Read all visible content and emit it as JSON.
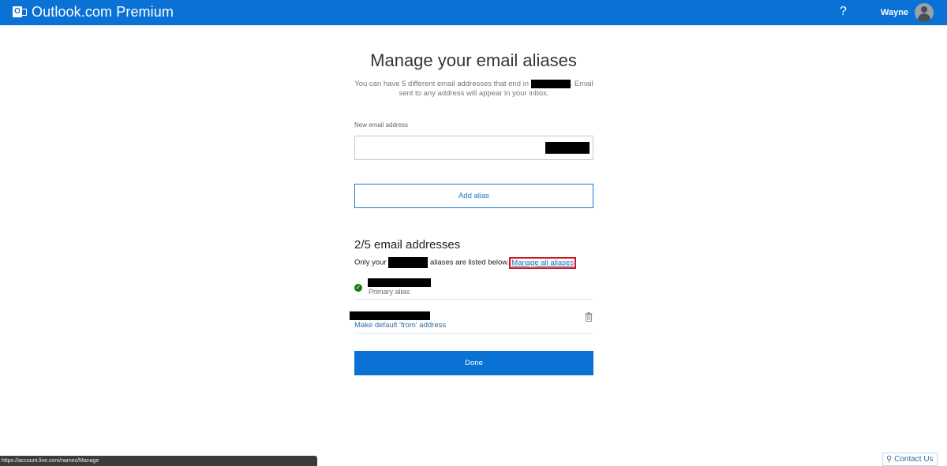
{
  "header": {
    "brand": "Outlook.com Premium",
    "help_label": "?",
    "user_name": "Wayne"
  },
  "main": {
    "title": "Manage your email aliases",
    "intro_before": "You can have 5 different email addresses that end in",
    "intro_after": ". Email sent to any address will appear in your inbox.",
    "new_email_label": "New email address",
    "new_email_value": "",
    "add_alias_label": "Add alias",
    "count_heading": "2/5 email addresses",
    "only_your": "Only your",
    "listed_below": "aliases are listed below.",
    "manage_all_link": "Manage all aliases",
    "aliases": [
      {
        "sub_label": "Primary alias"
      },
      {
        "action_label": "Make default 'from' address"
      }
    ],
    "done_label": "Done"
  },
  "footer": {
    "status_url": "https://account.live.com/names/Manage",
    "contact_label": "Contact Us"
  },
  "colors": {
    "header_bg": "#0a72d5",
    "accent": "#1e7ac6",
    "highlight_border": "#d2141e",
    "success": "#107c10"
  }
}
